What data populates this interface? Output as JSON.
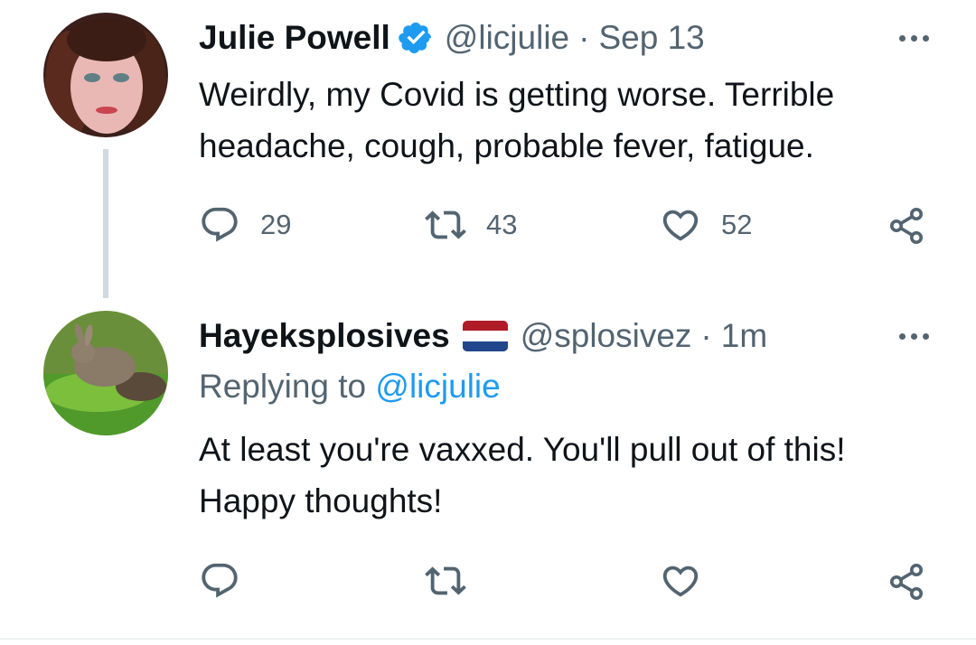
{
  "tweets": [
    {
      "name": "Julie Powell",
      "verified": true,
      "handle": "@licjulie",
      "separator": "·",
      "time": "Sep 13",
      "text": "Weirdly, my Covid is getting worse. Terrible headache, cough, probable fever, fatigue.",
      "counts": {
        "replies": "29",
        "retweets": "43",
        "likes": "52"
      }
    },
    {
      "name": "Hayeksplosives",
      "flag_icon": "netherlands-flag-icon",
      "handle": "@splosivez",
      "separator": "·",
      "time": "1m",
      "replying_prefix": "Replying to",
      "replying_handle": "@licjulie",
      "text": "At least you're vaxxed. You'll pull out of this! Happy thoughts!"
    }
  ],
  "colors": {
    "primary_text": "#0f1419",
    "secondary_text": "#536471",
    "accent": "#1d9bf0",
    "thread_line": "#cfd9de"
  },
  "icons": [
    "more-icon",
    "reply-icon",
    "retweet-icon",
    "like-icon",
    "share-icon",
    "verified-badge-icon"
  ]
}
